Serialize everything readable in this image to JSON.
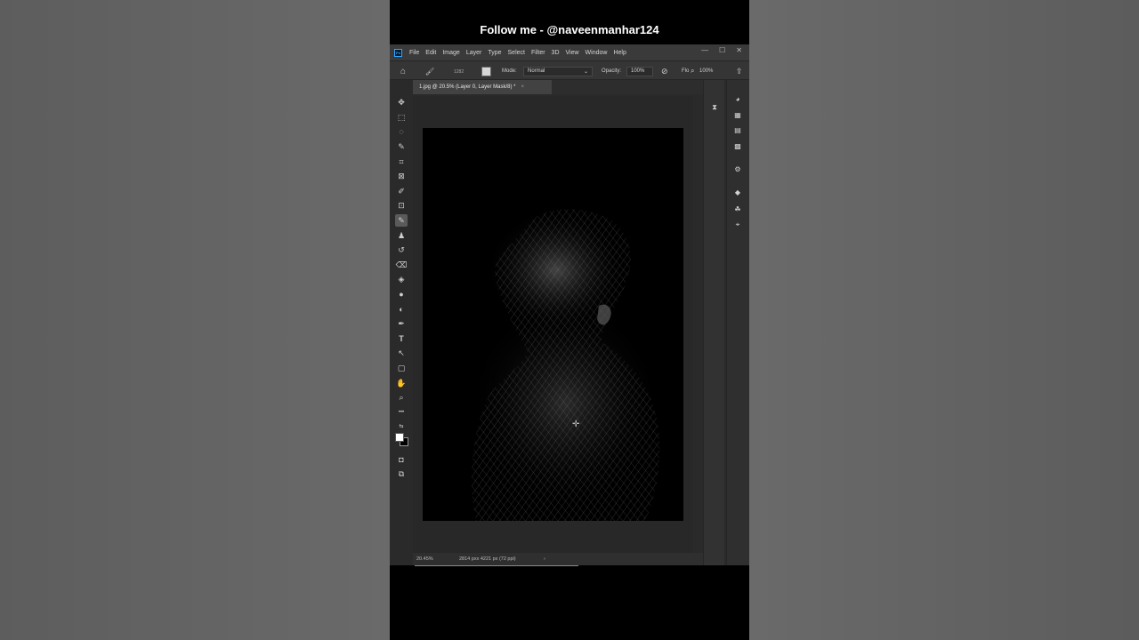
{
  "overlay": {
    "follow_text": "Follow me - @naveenmanhar124"
  },
  "app": {
    "logo_text": "Ps"
  },
  "menu": [
    "File",
    "Edit",
    "Image",
    "Layer",
    "Type",
    "Select",
    "Filter",
    "3D",
    "View",
    "Window",
    "Help"
  ],
  "window_controls": {
    "minimize": "—",
    "maximize": "☐",
    "close": "✕"
  },
  "options_bar": {
    "brush_size": "1282",
    "mode_label": "Mode:",
    "mode_value": "Normal",
    "opacity_label": "Opacity:",
    "opacity_value": "100%",
    "flow_label": "Flo",
    "flow_value": "100%"
  },
  "document_tab": {
    "title": "1.jpg @ 20.5% (Layer 0, Layer Mask/8) *",
    "close": "×"
  },
  "status": {
    "zoom": "20.45%",
    "doc_size": "2814 pxx 4221 px (72 ppi)",
    "arrow": "›"
  },
  "icons": {
    "home": "⌂",
    "brush": "🖌",
    "move": "✥",
    "marquee": "⬚",
    "lasso": "◌",
    "quick_select": "✎",
    "crop": "⌗",
    "frame": "⊠",
    "eyedropper": "✐",
    "patch": "⊡",
    "brush_tool": "✎",
    "stamp": "♟",
    "history_brush": "↺",
    "eraser": "⌫",
    "bucket": "◈",
    "blur": "●",
    "dodge": "◐",
    "pen": "✒",
    "type": "T",
    "path_select": "↖",
    "shape": "▢",
    "hand": "✋",
    "zoom": "⌕",
    "more": "•••",
    "quick_mask": "◘",
    "screen_mode": "⧉"
  },
  "colors": {
    "foreground": "#ffffff",
    "background": "#000000",
    "accent": "#31a8ff"
  }
}
